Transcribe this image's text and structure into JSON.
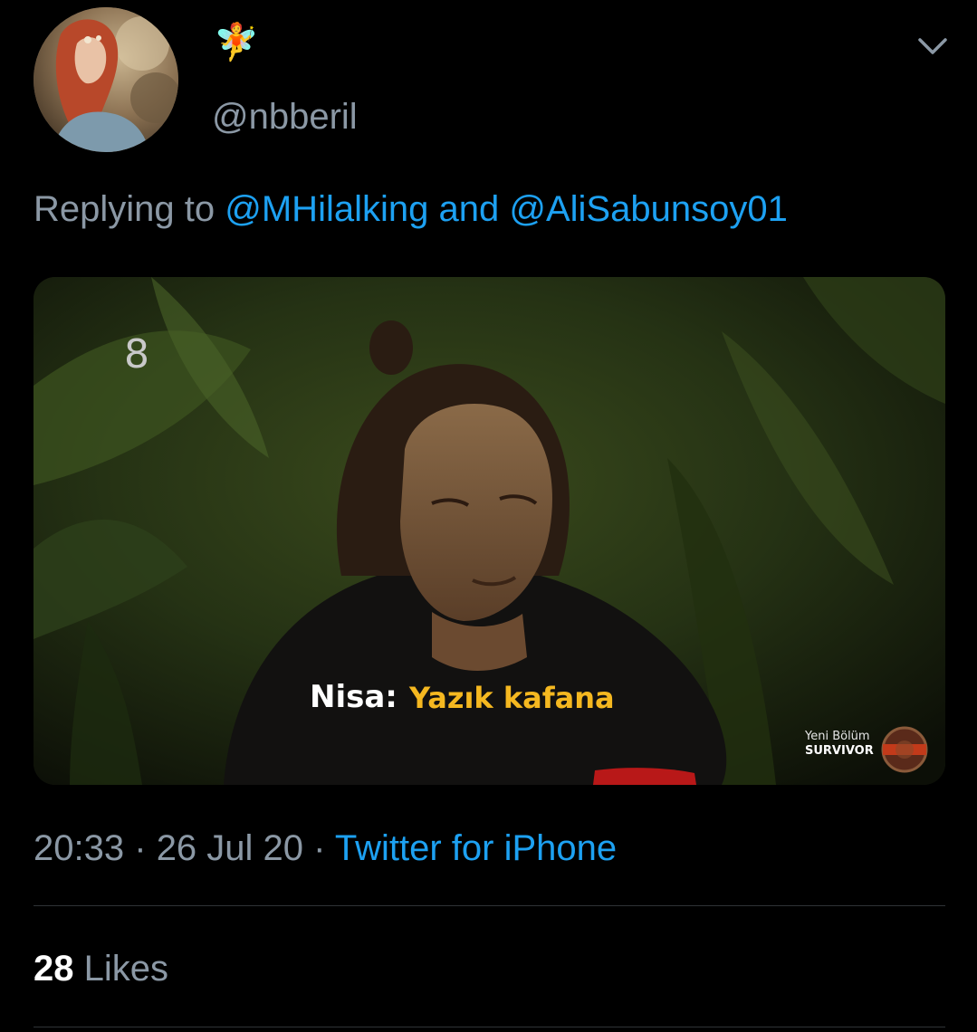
{
  "tweet": {
    "display_name": "🧚",
    "handle": "@nbberil",
    "reply": {
      "prefix": "Replying to",
      "mention1": "@MHilalking",
      "joiner": "and",
      "mention2": "@AliSabunsoy01"
    },
    "media": {
      "channel_number": "8",
      "subtitle_speaker": "Nisa:",
      "subtitle_text": "Yazık kafana",
      "promo_line1": "Yeni Bölüm",
      "promo_line2": "SURVIVOR"
    },
    "time": "20:33",
    "date": "26 Jul 20",
    "separator": "·",
    "source": "Twitter for iPhone",
    "likes_count": "28",
    "likes_label": "Likes"
  },
  "icons": {
    "menu": "chevron-down-icon"
  },
  "colors": {
    "background": "#000000",
    "secondary_text": "#8b98a5",
    "link": "#1da1f2",
    "divider": "#2f3336",
    "subtitle_yellow": "#f5b820"
  }
}
